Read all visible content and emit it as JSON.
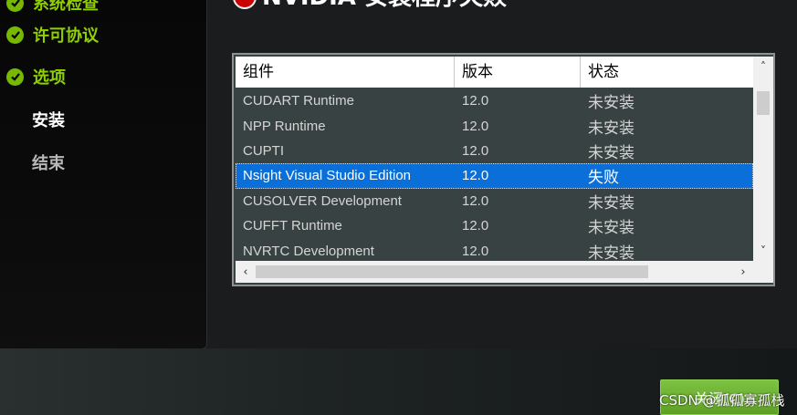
{
  "title": "NVIDIA 安装程序失败",
  "sidebar": {
    "steps": [
      {
        "label": "系统检查",
        "state": "done"
      },
      {
        "label": "许可协议",
        "state": "done"
      },
      {
        "label": "选项",
        "state": "done"
      },
      {
        "label": "安装",
        "state": "active"
      },
      {
        "label": "结束",
        "state": "pending"
      }
    ]
  },
  "table": {
    "headers": [
      "组件",
      "版本",
      "状态"
    ],
    "rows": [
      {
        "component": "CUDART Runtime",
        "version": "12.0",
        "status": "未安装"
      },
      {
        "component": "NPP Runtime",
        "version": "12.0",
        "status": "未安装"
      },
      {
        "component": "CUPTI",
        "version": "12.0",
        "status": "未安装"
      },
      {
        "component": "Nsight Visual Studio Edition",
        "version": "12.0",
        "status": "失败"
      },
      {
        "component": "CUSOLVER Development",
        "version": "12.0",
        "status": "未安装"
      },
      {
        "component": "CUFFT Runtime",
        "version": "12.0",
        "status": "未安装"
      },
      {
        "component": "NVRTC Development",
        "version": "12.0",
        "status": "未安装"
      }
    ],
    "selected_row": 3
  },
  "close_button": "关闭(C)",
  "watermark": "CSDN @孤孤寡孤栈",
  "colors": {
    "accent_green": "#76b900",
    "selection_blue": "#0a6fd8",
    "list_bg": "#394242"
  }
}
